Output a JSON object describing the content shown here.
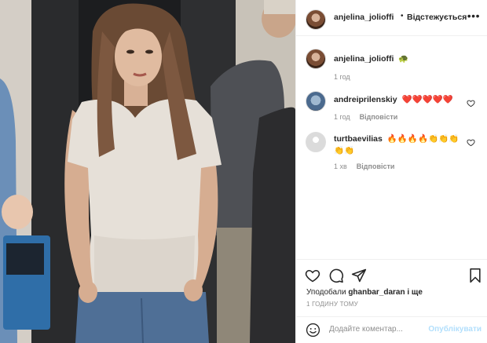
{
  "header": {
    "username": "anjelina_jolioffi",
    "separator": "•",
    "follow_status": "Відстежується",
    "more_icon": "more-horizontal-icon"
  },
  "caption": {
    "username": "anjelina_jolioffi",
    "text": "🐢",
    "time": "1 год"
  },
  "comments": [
    {
      "username": "andreiprilenskiy",
      "text": "❤️❤️❤️❤️❤️",
      "time": "1 год",
      "reply": "Відповісти"
    },
    {
      "username": "turtbaevilias",
      "text": "🔥🔥🔥🔥👏👏👏👏👏",
      "time": "1 хв",
      "reply": "Відповісти"
    }
  ],
  "actions": {
    "like_icon": "heart-icon",
    "comment_icon": "comment-icon",
    "share_icon": "send-icon",
    "save_icon": "bookmark-icon"
  },
  "likes": {
    "prefix": "Уподобали",
    "user": "ghanbar_daran",
    "suffix": "і ще"
  },
  "timestamp": "1 ГОДИНУ ТОМУ",
  "add_comment": {
    "placeholder": "Додайте коментар...",
    "post_label": "Опублікувати",
    "post_color": "#b2dffc"
  }
}
